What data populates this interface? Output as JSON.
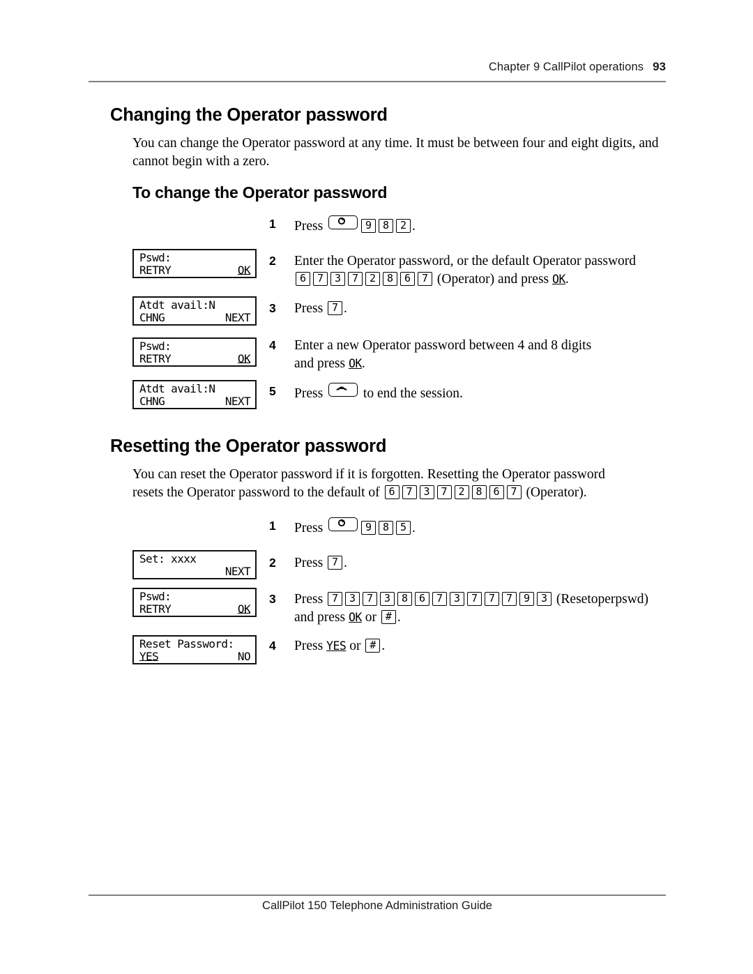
{
  "header": {
    "chapter": "Chapter 9  CallPilot operations",
    "page_number": "93"
  },
  "footer": {
    "guide_title": "CallPilot 150 Telephone Administration Guide"
  },
  "sections": {
    "changing": {
      "heading": "Changing the Operator password",
      "intro": "You can change the Operator password at any time. It must be between four and eight digits, and cannot begin with a zero.",
      "subheading": "To change the Operator password",
      "steps": {
        "s1": {
          "number": "1",
          "prefix": "Press",
          "keys": [
            "9",
            "8",
            "2"
          ],
          "feature_key_icon": "feature-key-icon",
          "suffix": "."
        },
        "s2": {
          "number": "2",
          "line1": "Enter the Operator password, or the default Operator password",
          "keys": [
            "6",
            "7",
            "3",
            "7",
            "2",
            "8",
            "6",
            "7"
          ],
          "note": "(Operator) and press",
          "softkey": "OK",
          "suffix": "."
        },
        "s3": {
          "number": "3",
          "prefix": "Press",
          "keys": [
            "7"
          ],
          "suffix": "."
        },
        "s4": {
          "number": "4",
          "line1": "Enter a new Operator password between 4 and 8 digits",
          "line2_prefix": "and press",
          "softkey": "OK",
          "suffix": "."
        },
        "s5": {
          "number": "5",
          "prefix": "Press",
          "release_key_icon": "release-handset-key-icon",
          "suffix": "to end the session."
        }
      },
      "displays": [
        {
          "line1": "Pswd:",
          "left": "RETRY",
          "right": "OK",
          "right_underlined": true
        },
        {
          "line1": "Atdt avail:N",
          "left": "CHNG",
          "right": "NEXT",
          "right_underlined": false
        },
        {
          "line1": "Pswd:",
          "left": "RETRY",
          "right": "OK",
          "right_underlined": true
        },
        {
          "line1": "Atdt avail:N",
          "left": "CHNG",
          "right": "NEXT",
          "right_underlined": false
        }
      ]
    },
    "resetting": {
      "heading": "Resetting the Operator password",
      "intro_line1": "You can reset the Operator password if it is forgotten. Resetting the Operator password",
      "intro_line2_prefix": "resets the Operator password to the default of",
      "intro_keys": [
        "6",
        "7",
        "3",
        "7",
        "2",
        "8",
        "6",
        "7"
      ],
      "intro_line2_suffix": "(Operator).",
      "steps": {
        "s1": {
          "number": "1",
          "prefix": "Press",
          "feature_key_icon": "feature-key-icon",
          "keys": [
            "9",
            "8",
            "5"
          ],
          "suffix": "."
        },
        "s2": {
          "number": "2",
          "prefix": "Press",
          "keys": [
            "7"
          ],
          "suffix": "."
        },
        "s3": {
          "number": "3",
          "prefix": "Press",
          "keys": [
            "7",
            "3",
            "7",
            "3",
            "8",
            "6",
            "7",
            "3",
            "7",
            "7",
            "7",
            "9",
            "3"
          ],
          "note": "(Resetoperpswd)",
          "line2_prefix": "and press",
          "softkey": "OK",
          "line2_mid": "or",
          "hash_key": "#",
          "suffix": "."
        },
        "s4": {
          "number": "4",
          "prefix": "Press",
          "softkey": "YES",
          "mid": "or",
          "hash_key": "#",
          "suffix": "."
        }
      },
      "displays": [
        {
          "line1": "Set: xxxx",
          "left": "",
          "right": "NEXT",
          "right_underlined": false
        },
        {
          "line1": "Pswd:",
          "left": "RETRY",
          "right": "OK",
          "right_underlined": true
        },
        {
          "line1": "Reset Password:",
          "left": "YES",
          "right": "NO",
          "left_underlined": true,
          "right_underlined": false
        }
      ]
    }
  }
}
